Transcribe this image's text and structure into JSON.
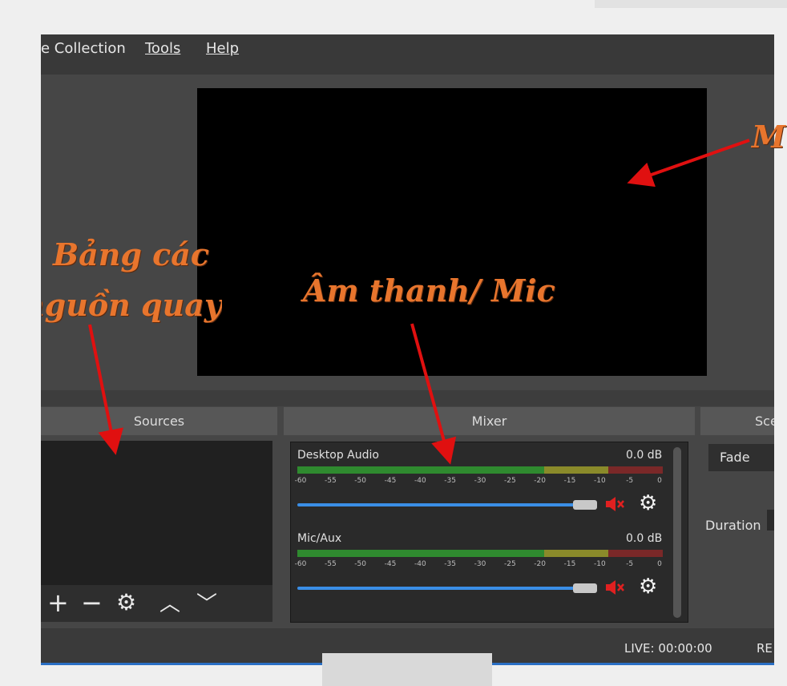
{
  "menu": {
    "scene_collection": "e Collection",
    "tools": "Tools",
    "help": "Help"
  },
  "docks": {
    "sources_title": "Sources",
    "mixer_title": "Mixer",
    "transitions_title": "Sce"
  },
  "mixer": {
    "channels": [
      {
        "name": "Desktop Audio",
        "db": "0.0 dB",
        "volume": 1.0
      },
      {
        "name": "Mic/Aux",
        "db": "0.0 dB",
        "volume": 1.0
      }
    ],
    "ticks": [
      "-60",
      "-55",
      "-50",
      "-45",
      "-40",
      "-35",
      "-30",
      "-25",
      "-20",
      "-15",
      "-10",
      "-5",
      "0"
    ]
  },
  "transitions": {
    "selected": "Fade",
    "duration_label": "Duration"
  },
  "status": {
    "live": "LIVE: 00:00:00",
    "rec": "RE"
  },
  "annotations": {
    "preview": "M",
    "sources_line1": "Bảng các",
    "sources_line2": "nguồn quay",
    "mixer": "Âm thanh/ Mic"
  },
  "colors": {
    "annotation": "#e8752d",
    "arrow": "#e01010",
    "slider": "#3a8ee6"
  }
}
